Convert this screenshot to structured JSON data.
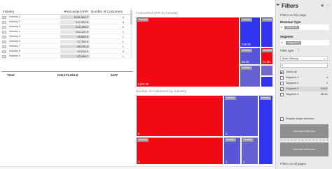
{
  "table": {
    "headers": {
      "industry": "Industry",
      "forecasted_arr": "Forecasted ARR",
      "customers": "Number of Customers"
    },
    "rows": [
      {
        "name": "Industry 1",
        "arr": "£191,864.7",
        "customers": "6"
      },
      {
        "name": "Industry 2",
        "arr": "£17,322.5",
        "customers": "4"
      },
      {
        "name": "Industry 3",
        "arr": "£12,456.1",
        "customers": "2"
      },
      {
        "name": "Industry 4",
        "arr": "£10,101.9",
        "customers": "1"
      },
      {
        "name": "Industry 5",
        "arr": "£9,882.0",
        "customers": "1"
      },
      {
        "name": "Industry 6",
        "arr": "£7,334.8",
        "customers": "1"
      },
      {
        "name": "Industry 7",
        "arr": "£6,210.4",
        "customers": "1"
      },
      {
        "name": "Industry 8",
        "arr": "£5,003.2",
        "customers": "0"
      },
      {
        "name": "Industry 9",
        "arr": "£2,948.7",
        "customers": "1"
      }
    ],
    "total": {
      "label": "Total",
      "arr": "£18,171,924.8",
      "customers": "5437"
    }
  },
  "treemap_arr": {
    "title": "Forecasted ARR by Industry",
    "tiles": [
      {
        "label": "Industry",
        "value": "£101.9K"
      },
      {
        "label": "Industry",
        "value": "£35.0K"
      },
      {
        "label": "Industry",
        "value": "£6.2K"
      },
      {
        "label": "Industry",
        "value": "£7.3K"
      },
      {
        "label": "Industry",
        "value": ""
      },
      {
        "label": "Industry",
        "value": ""
      }
    ]
  },
  "treemap_customers": {
    "title": "Number of Customers by Industry",
    "tiles": [
      {
        "label": "Industry",
        "value": "6"
      },
      {
        "label": "Industry",
        "value": "4"
      },
      {
        "label": "Industry",
        "value": "2"
      },
      {
        "label": "Industry",
        "value": "1"
      },
      {
        "label": "Industry",
        "value": "1"
      },
      {
        "label": "Industry",
        "value": "1"
      },
      {
        "label": "Industry",
        "value": ""
      }
    ]
  },
  "filters": {
    "title": "Filters",
    "this_page": "Filters on this page",
    "revenue_type": {
      "title": "Revenue Type",
      "is": "is",
      "value": "Recurrent"
    },
    "segment": {
      "title": "Segment",
      "is": "is",
      "value": "Segment 3"
    },
    "filter_type_label": "Filter type",
    "filter_type_value": "Basic filtering",
    "select_all": "Select all",
    "items": [
      {
        "label": "Segment 1",
        "count": "4",
        "checked": false
      },
      {
        "label": "Segment 2",
        "count": "2",
        "checked": false
      },
      {
        "label": "Segment 3",
        "count": "49920",
        "checked": true
      },
      {
        "label": "Segment 4",
        "count": "16151",
        "checked": false
      }
    ],
    "require_single": "Require single selection",
    "add_fields_1": "Add data fields here",
    "add_fields_2": "Add data fields here",
    "all_pages": "Filters on all pages"
  },
  "colors": {
    "red": "#f00a14",
    "blue": "#3033f0",
    "purple": "#5a54d8",
    "pane": "#eaeaea"
  },
  "icons": {
    "filter": "funnel-icon",
    "visibility": "eye-icon",
    "expand": "chevron-right-icon",
    "search": "search-icon"
  }
}
